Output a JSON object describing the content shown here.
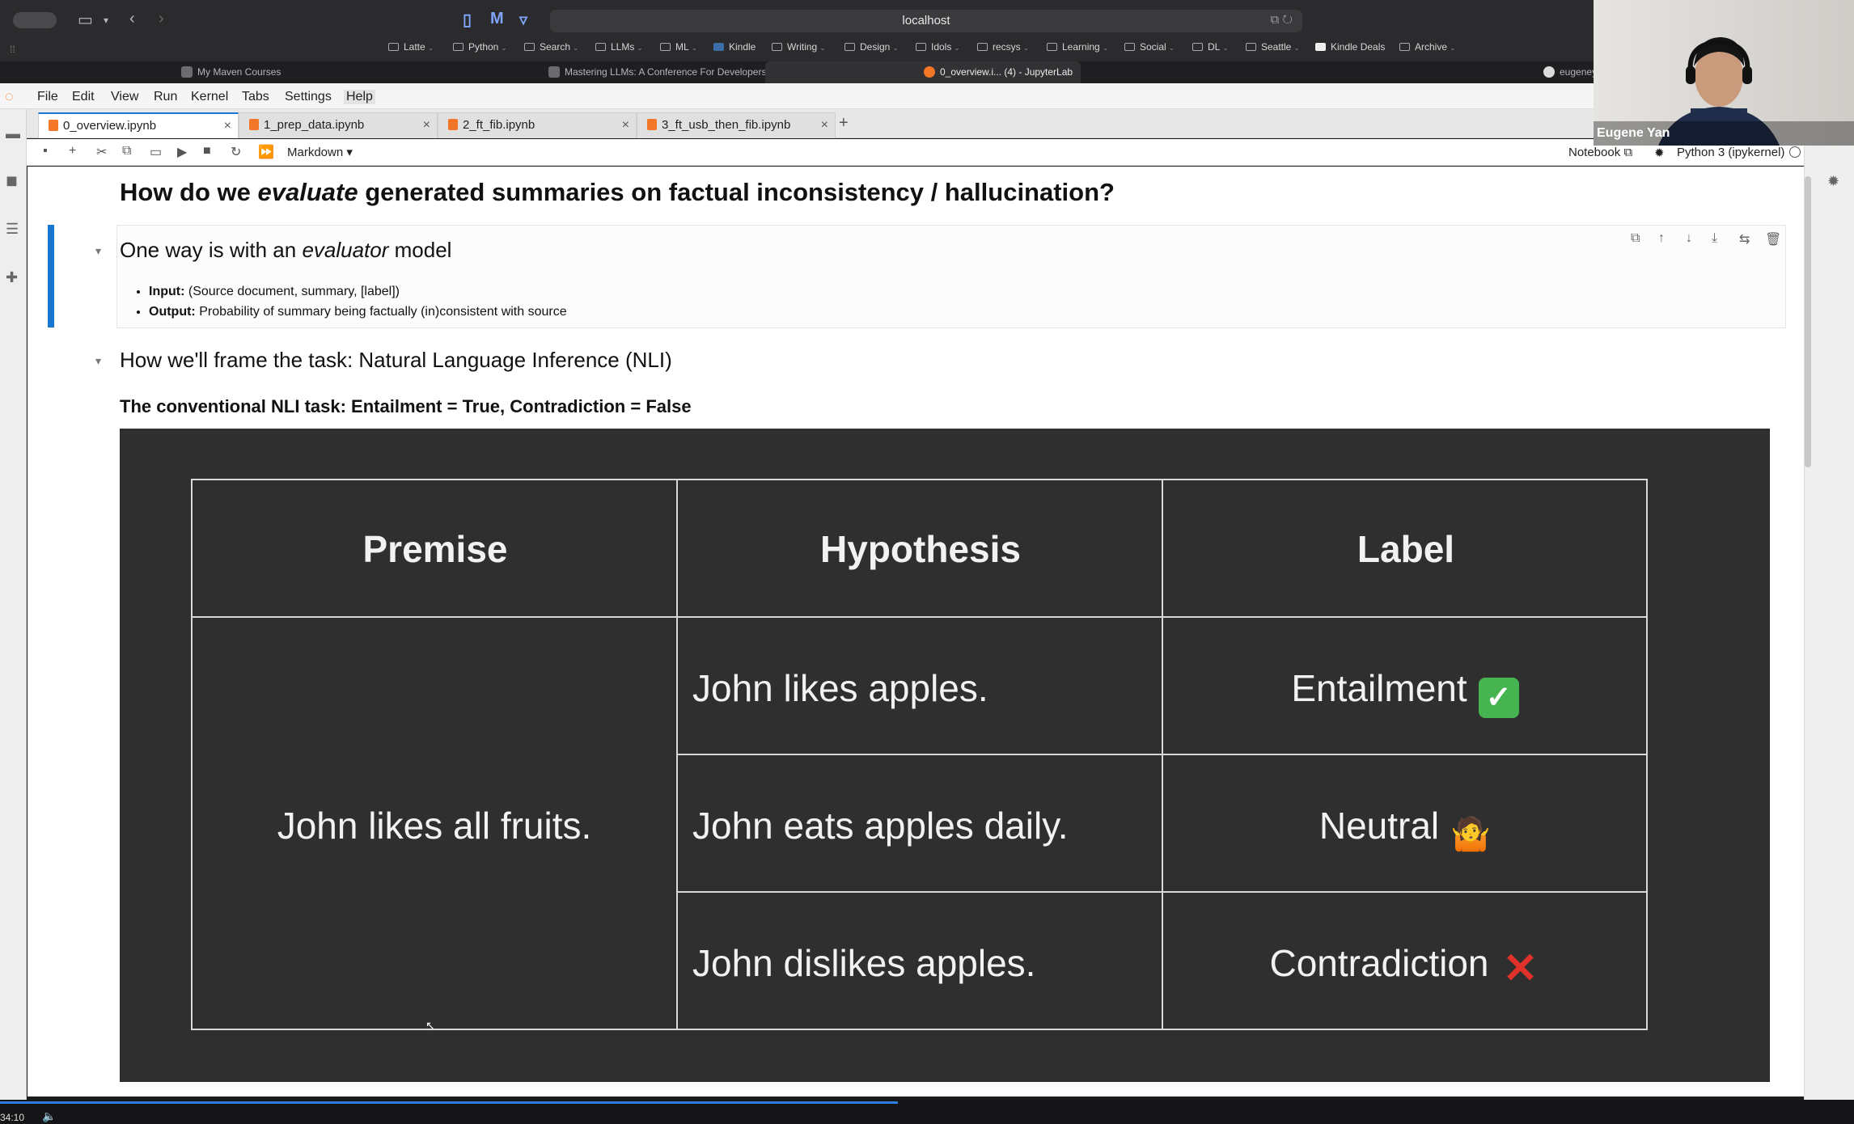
{
  "browser": {
    "address": "localhost",
    "bookmarks": [
      "Latte",
      "Python",
      "Search",
      "LLMs",
      "ML",
      "Kindle",
      "Writing",
      "Design",
      "Idols",
      "recsys",
      "Learning",
      "Social",
      "DL",
      "Seattle",
      "Kindle Deals",
      "Archive"
    ],
    "tabs": [
      "My Maven Courses",
      "Mastering LLMs: A Conference For Developers & Data Scientists",
      "0_overview.i... (4) - JupyterLab",
      "eugeneya"
    ]
  },
  "jupyter": {
    "menu": [
      "File",
      "Edit",
      "View",
      "Run",
      "Kernel",
      "Tabs",
      "Settings",
      "Help"
    ],
    "notebook_tabs": [
      "0_overview.ipynb",
      "1_prep_data.ipynb",
      "2_ft_fib.ipynb",
      "3_ft_usb_then_fib.ipynb"
    ],
    "cell_type": "Markdown",
    "notebook_label": "Notebook",
    "kernel": "Python 3 (ipykernel)"
  },
  "content": {
    "h1_pre": "How do we ",
    "h1_em": "evaluate",
    "h1_post": " generated summaries on factual inconsistency / hallucination?",
    "h2a_pre": "One way is with an ",
    "h2a_em": "evaluator",
    "h2a_post": " model",
    "input_label": "Input:",
    "input_text": " (Source document, summary, [label])",
    "output_label": "Output:",
    "output_text": " Probability of summary being factually (in)consistent with source",
    "h2b": "How we'll frame the task: Natural Language Inference (NLI)",
    "subheading": "The conventional NLI task: Entailment = True, Contradiction = False"
  },
  "table": {
    "headers": [
      "Premise",
      "Hypothesis",
      "Label"
    ],
    "premise": "John likes all fruits.",
    "rows": [
      {
        "hypothesis": "John likes apples.",
        "label": "Entailment",
        "emoji": "✓",
        "color": "#46b450"
      },
      {
        "hypothesis": "John eats apples daily.",
        "label": "Neutral",
        "emoji": "🤷",
        "color": "#f5a623"
      },
      {
        "hypothesis": "John dislikes apples.",
        "label": "Contradiction",
        "emoji": "✕",
        "color": "#e0312b"
      }
    ]
  },
  "webcam": {
    "name": "Eugene Yan"
  },
  "player": {
    "time": "34:10"
  }
}
